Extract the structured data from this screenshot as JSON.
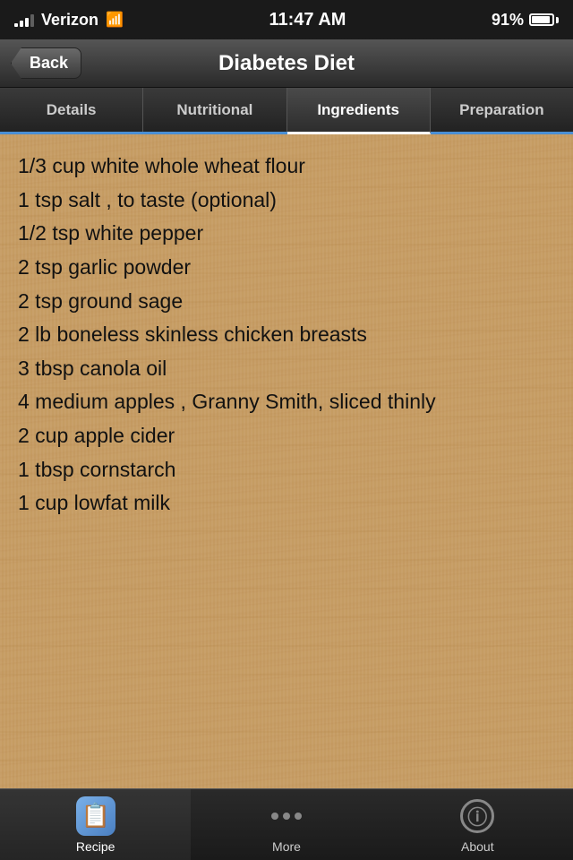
{
  "statusBar": {
    "carrier": "Verizon",
    "time": "11:47 AM",
    "battery": "91%"
  },
  "navBar": {
    "backLabel": "Back",
    "title": "Diabetes Diet"
  },
  "tabs": [
    {
      "id": "details",
      "label": "Details",
      "active": false
    },
    {
      "id": "nutritional",
      "label": "Nutritional",
      "active": false
    },
    {
      "id": "ingredients",
      "label": "Ingredients",
      "active": true
    },
    {
      "id": "preparation",
      "label": "Preparation",
      "active": false
    }
  ],
  "ingredients": [
    "1/3 cup white whole wheat flour",
    "1 tsp salt , to taste (optional)",
    "1/2 tsp white pepper",
    "2 tsp garlic powder",
    "2 tsp ground sage",
    "2 lb boneless skinless chicken breasts",
    "3 tbsp canola oil",
    "4 medium apples , Granny Smith, sliced thinly",
    "2 cup apple cider",
    "1 tbsp cornstarch",
    "1 cup lowfat milk"
  ],
  "bottomNav": [
    {
      "id": "recipe",
      "label": "Recipe",
      "active": true,
      "icon": "recipe-icon"
    },
    {
      "id": "more",
      "label": "More",
      "active": false,
      "icon": "more-icon"
    },
    {
      "id": "about",
      "label": "About",
      "active": false,
      "icon": "about-icon"
    }
  ]
}
